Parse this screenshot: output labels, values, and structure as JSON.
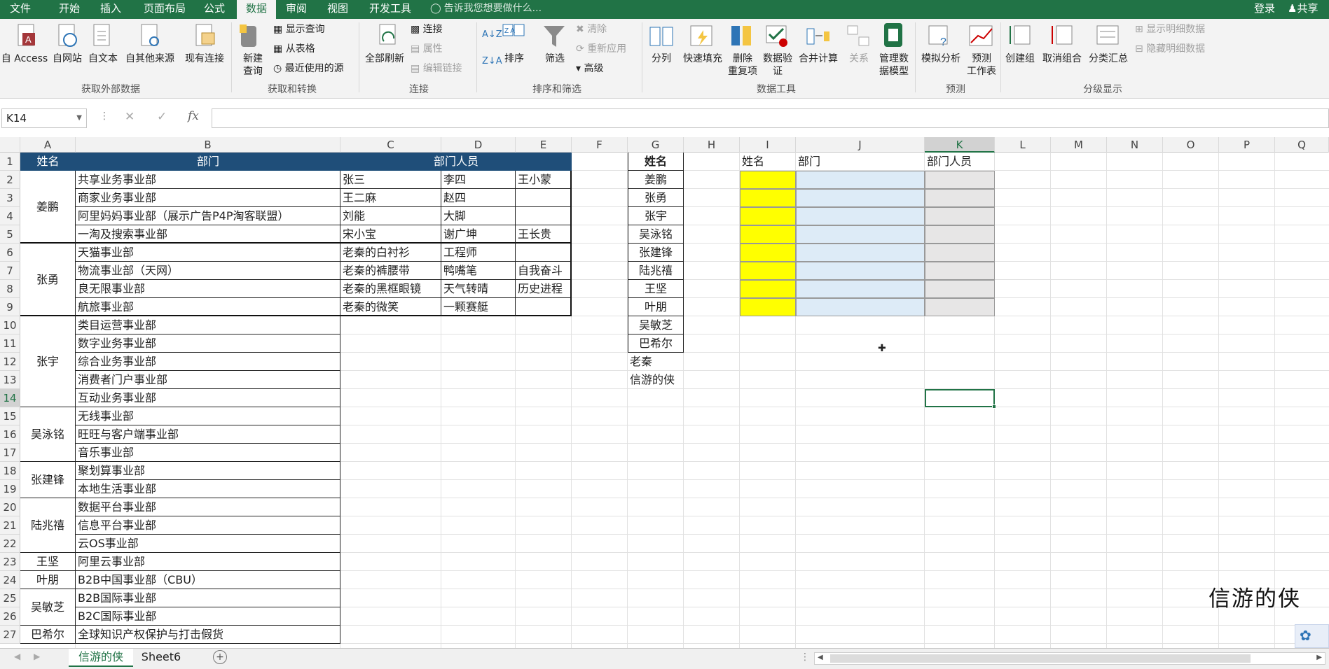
{
  "menu": {
    "tabs": [
      "文件",
      "开始",
      "插入",
      "页面布局",
      "公式",
      "数据",
      "审阅",
      "视图",
      "开发工具"
    ],
    "active": "数据",
    "tell_me": "告诉我您想要做什么...",
    "login": "登录",
    "share": "共享"
  },
  "ribbon": {
    "groups": {
      "external": "获取外部数据",
      "transform": "获取和转换",
      "connections": "连接",
      "sortfilter": "排序和筛选",
      "datatools": "数据工具",
      "forecast": "预测",
      "outline": "分级显示"
    },
    "buttons": {
      "from_access": "自 Access",
      "from_web": "自网站",
      "from_text": "自文本",
      "from_other": "自其他来源",
      "existing": "现有连接",
      "new_query_1": "新建",
      "new_query_2": "查询",
      "show_query": "显示查询",
      "from_table": "从表格",
      "recent_sources": "最近使用的源",
      "refresh_all": "全部刷新",
      "connections": "连接",
      "properties": "属性",
      "edit_links": "编辑链接",
      "sort": "排序",
      "filter": "筛选",
      "clear": "清除",
      "reapply": "重新应用",
      "advanced": "高级",
      "text_to_columns": "分列",
      "flash_fill": "快速填充",
      "remove_dup_1": "删除",
      "remove_dup_2": "重复项",
      "validation_1": "数据验",
      "validation_2": "证",
      "consolidate": "合并计算",
      "relationships": "关系",
      "manage_model_1": "管理数",
      "manage_model_2": "据模型",
      "what_if": "模拟分析",
      "forecast_1": "预测",
      "forecast_2": "工作表",
      "group": "创建组",
      "ungroup": "取消组合",
      "subtotal": "分类汇总",
      "show_detail": "显示明细数据",
      "hide_detail": "隐藏明细数据"
    }
  },
  "formula_bar": {
    "name_box": "K14",
    "fx": "fx",
    "value": ""
  },
  "columns": [
    "A",
    "B",
    "C",
    "D",
    "E",
    "F",
    "G",
    "H",
    "I",
    "J",
    "K",
    "L",
    "M",
    "N",
    "O",
    "P",
    "Q"
  ],
  "rows": [
    "1",
    "2",
    "3",
    "4",
    "5",
    "6",
    "7",
    "8",
    "9",
    "10",
    "11",
    "12",
    "13",
    "14",
    "15",
    "16",
    "17",
    "18",
    "19",
    "20",
    "21",
    "22",
    "23",
    "24",
    "25",
    "26",
    "27"
  ],
  "selected_cell": "K14",
  "table1": {
    "headers": [
      "姓名",
      "部门",
      "部门人员"
    ],
    "owners": [
      "姜鹏",
      "张勇"
    ],
    "depts": [
      "共享业务事业部",
      "商家业务事业部",
      "阿里妈妈事业部（展示广告P4P淘客联盟）",
      "一淘及搜索事业部",
      "天猫事业部",
      "物流事业部（天网）",
      "良无限事业部",
      "航旅事业部"
    ],
    "members": [
      [
        "张三",
        "李四",
        "王小蒙"
      ],
      [
        "王二麻",
        "赵四",
        ""
      ],
      [
        "刘能",
        "大脚",
        ""
      ],
      [
        "宋小宝",
        "谢广坤",
        "王长贵"
      ],
      [
        "老秦的白衬衫",
        "工程师",
        ""
      ],
      [
        "老秦的裤腰带",
        "鸭嘴笔",
        "自我奋斗"
      ],
      [
        "老秦的黑框眼镜",
        "天气转晴",
        "历史进程"
      ],
      [
        "老秦的微笑",
        "一颗赛艇",
        ""
      ]
    ]
  },
  "lower_table": {
    "owners": [
      "张宇",
      "吴泳铭",
      "张建锋",
      "陆兆禧",
      "王坚",
      "叶朋",
      "吴敏芝",
      "巴希尔"
    ],
    "depts": [
      "类目运营事业部",
      "数字业务事业部",
      "综合业务事业部",
      "消费者门户事业部",
      "互动业务事业部",
      "无线事业部",
      "旺旺与客户端事业部",
      "音乐事业部",
      "聚划算事业部",
      "本地生活事业部",
      "数据平台事业部",
      "信息平台事业部",
      "云OS事业部",
      "阿里云事业部",
      "B2B中国事业部（CBU）",
      "B2B国际事业部",
      "B2C国际事业部",
      "全球知识产权保护与打击假货"
    ]
  },
  "name_list": {
    "header": "姓名",
    "names": [
      "姜鹏",
      "张勇",
      "张宇",
      "吴泳铭",
      "张建锋",
      "陆兆禧",
      "王坚",
      "叶朋",
      "吴敏芝",
      "巴希尔"
    ],
    "extra": [
      "老秦",
      "信游的侠"
    ]
  },
  "lookup": {
    "headers": [
      "姓名",
      "部门",
      "部门人员"
    ]
  },
  "sheets": [
    "信游的侠",
    "Sheet6"
  ],
  "active_sheet": "信游的侠",
  "watermark": "信游的侠",
  "colors": {
    "excel_green": "#217346",
    "header_fill": "#1f4e79",
    "yellow": "#ffff00",
    "light_blue": "#ddebf7",
    "light_gray": "#e7e6e6"
  }
}
